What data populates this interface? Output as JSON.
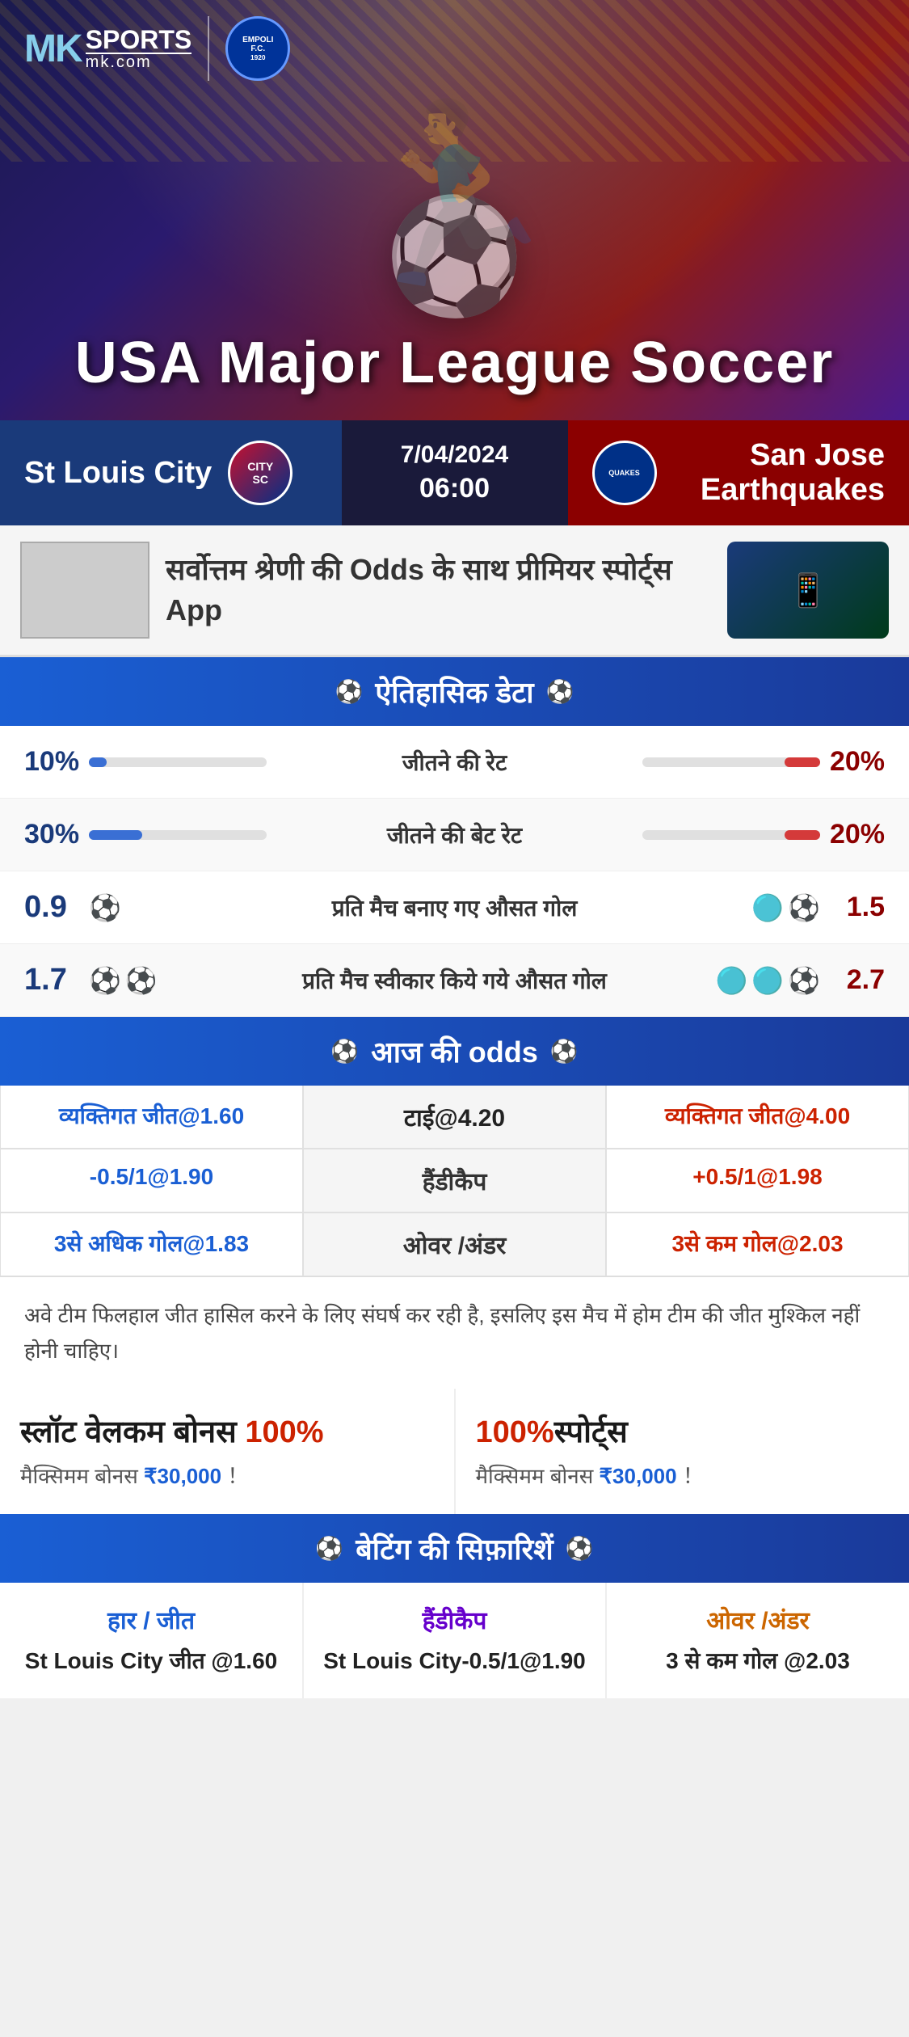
{
  "brand": {
    "mk": "MK",
    "sports": "SPORTS",
    "domain": "mk.com",
    "empoli": "EMPOLI F.C.\n1920"
  },
  "hero": {
    "title": "USA Major League Soccer"
  },
  "match": {
    "team_left": "St Louis City",
    "team_right": "San Jose Earthquakes",
    "date": "7/04/2024",
    "time": "06:00",
    "team_right_short": "QUAKES"
  },
  "promo": {
    "text": "सर्वोत्तम श्रेणी की Odds के साथ प्रीमियर स्पोर्ट्स App"
  },
  "historical": {
    "section_title": "ऐतिहासिक डेटा",
    "rows": [
      {
        "label": "जीतने की रेट",
        "left_val": "10%",
        "right_val": "20%",
        "left_pct": 10,
        "right_pct": 20
      },
      {
        "label": "जीतने की बेट रेट",
        "left_val": "30%",
        "right_val": "20%",
        "left_pct": 30,
        "right_pct": 20
      },
      {
        "label": "प्रति मैच बनाए गए औसत गोल",
        "left_val": "0.9",
        "right_val": "1.5",
        "left_balls": 1,
        "right_balls": 2
      },
      {
        "label": "प्रति मैच स्वीकार किये गये औसत गोल",
        "left_val": "1.7",
        "right_val": "2.7",
        "left_balls": 2,
        "right_balls": 3
      }
    ]
  },
  "odds": {
    "section_title": "आज की odds",
    "rows": [
      {
        "left": "व्यक्तिगत जीत@1.60",
        "center": "टाई@4.20",
        "right": "व्यक्तिगत जीत@4.00"
      },
      {
        "left": "-0.5/1@1.90",
        "center": "हैंडीकैप",
        "right": "+0.5/1@1.98"
      },
      {
        "left": "3से अधिक गोल@1.83",
        "center": "ओवर /अंडर",
        "right": "3से कम गोल@2.03"
      }
    ]
  },
  "notice": {
    "text": "अवे टीम फिलहाल जीत हासिल करने के लिए संघर्ष कर रही है, इसलिए इस मैच में होम टीम की जीत मुश्किल नहीं होनी चाहिए।"
  },
  "bonus": {
    "left_title": "स्लॉट वेलकम बोनस 100%",
    "left_subtitle": "मैक्सिमम बोनस ₹30,000  ！",
    "right_title": "100%स्पोर्ट्स",
    "right_subtitle": "मैक्सिमम बोनस  ₹30,000 ！"
  },
  "betting": {
    "section_title": "बेटिंग की सिफ़ारिशें",
    "cols": [
      {
        "type": "हार / जीत",
        "rec": "St Louis City जीत @1.60"
      },
      {
        "type": "हैंडीकैप",
        "rec": "St Louis City-0.5/1@1.90"
      },
      {
        "type": "ओवर /अंडर",
        "rec": "3 से कम गोल @2.03"
      }
    ]
  }
}
